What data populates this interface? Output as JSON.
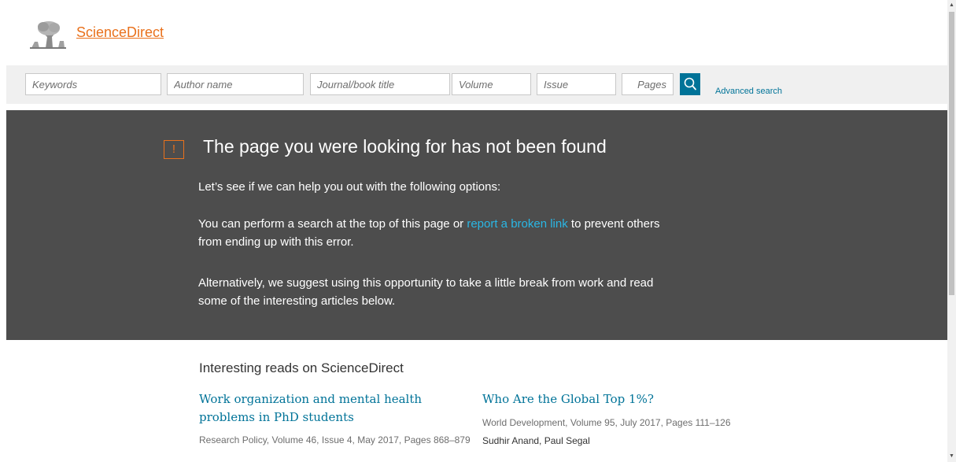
{
  "header": {
    "brand": "ScienceDirect"
  },
  "search": {
    "keywords_placeholder": "Keywords",
    "author_placeholder": "Author name",
    "journal_placeholder": "Journal/book title",
    "volume_placeholder": "Volume",
    "issue_placeholder": "Issue",
    "pages_placeholder": "Pages",
    "advanced_label": "Advanced search"
  },
  "error": {
    "icon_glyph": "!",
    "title": "The page you were looking for has not been found",
    "intro": "Let’s see if we can help you out with the following options:",
    "p2_before": "You can perform a search at the top of this page or ",
    "p2_link": "report a broken link",
    "p2_after": " to prevent others from ending up with this error.",
    "p3": "Alternatively, we suggest using this opportunity to take a little break from work and read some of the interesting articles below."
  },
  "reads": {
    "heading": "Interesting reads on ScienceDirect",
    "articles": [
      {
        "title": "Work organization and mental health problems in PhD students",
        "meta": "Research Policy, Volume 46, Issue 4, May 2017, Pages 868–879",
        "authors": ""
      },
      {
        "title": "Who Are the Global Top 1%?",
        "meta": "World Development, Volume 95, July 2017, Pages 111–126",
        "authors": "Sudhir Anand, Paul Segal"
      }
    ]
  },
  "colors": {
    "brand": "#e9711c",
    "link": "#007398",
    "hero_bg": "#4d4d4d",
    "hero_link": "#2ab7e5"
  }
}
